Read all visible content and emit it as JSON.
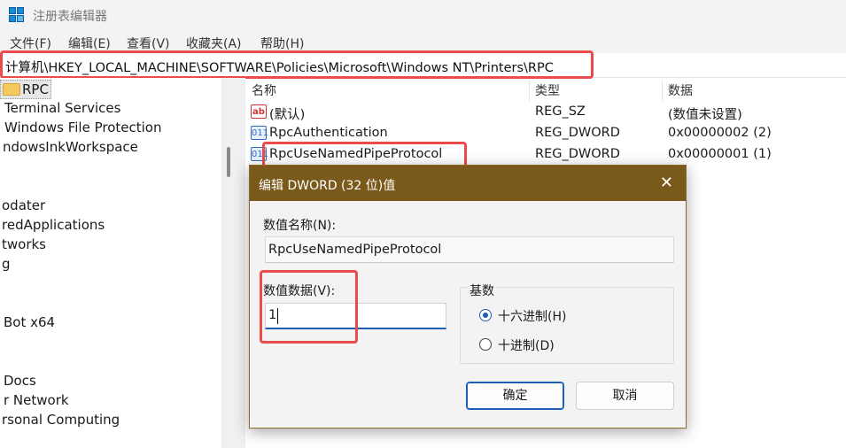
{
  "window": {
    "title": "注册表编辑器",
    "icon": "registry-editor-icon"
  },
  "menu": [
    "文件(F)",
    "编辑(E)",
    "查看(V)",
    "收藏夹(A)",
    "帮助(H)"
  ],
  "address": {
    "path": "计算机\\HKEY_LOCAL_MACHINE\\SOFTWARE\\Policies\\Microsoft\\Windows NT\\Printers\\RPC"
  },
  "tree": {
    "selected": "RPC",
    "items": [
      "Terminal Services",
      "Windows File Protection",
      "ndowsInkWorkspace",
      "odater",
      "redApplications",
      "tworks",
      "g",
      "Bot x64",
      "Docs",
      "r Network",
      "rsonal Computing"
    ]
  },
  "list": {
    "columns": {
      "name": "名称",
      "type": "类型",
      "data": "数据"
    },
    "rows": [
      {
        "name": "(默认)",
        "type": "REG_SZ",
        "data": "(数值未设置)",
        "icon": "string-value-icon"
      },
      {
        "name": "RpcAuthentication",
        "type": "REG_DWORD",
        "data": "0x00000002 (2)",
        "icon": "dword-value-icon"
      },
      {
        "name": "RpcUseNamedPipeProtocol",
        "type": "REG_DWORD",
        "data": "0x00000001 (1)",
        "icon": "dword-value-icon"
      }
    ]
  },
  "dialog": {
    "title": "编辑 DWORD (32 位)值",
    "name_label": "数值名称(N):",
    "name_value": "RpcUseNamedPipeProtocol",
    "data_label": "数值数据(V):",
    "data_value": "1",
    "base_label": "基数",
    "hex_label": "十六进制(H)",
    "dec_label": "十进制(D)",
    "ok_label": "确定",
    "cancel_label": "取消",
    "close_glyph": "✕"
  },
  "colors": {
    "highlight": "#ec4b4b",
    "accent": "#1c5fb4",
    "dialog_title": "#7a5a1a"
  }
}
